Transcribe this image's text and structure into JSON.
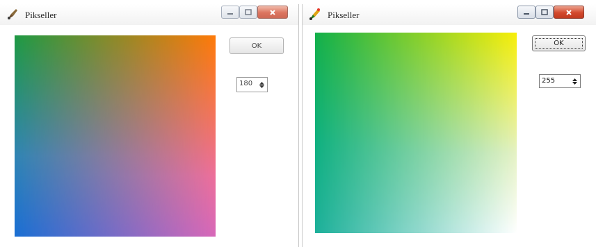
{
  "windows": [
    {
      "title": "Pikseller",
      "ok_label": "OK",
      "spin_value": "180",
      "gradient_colors": {
        "top_left": "#1e9a44",
        "top_right": "#ff7a08",
        "bottom_left": "#1a6fd4",
        "bottom_right": "#d868b8"
      }
    },
    {
      "title": "Pikseller",
      "ok_label": "OK",
      "spin_value": "255",
      "gradient_colors": {
        "top_left": "#12b04a",
        "top_right": "#f8ee08",
        "bottom_left": "#1cb09a",
        "bottom_right": "#ffffff"
      }
    }
  ],
  "icons": [
    "paint-app-icon",
    "minimize-icon",
    "maximize-icon",
    "close-icon",
    "spin-up-icon",
    "spin-down-icon"
  ]
}
